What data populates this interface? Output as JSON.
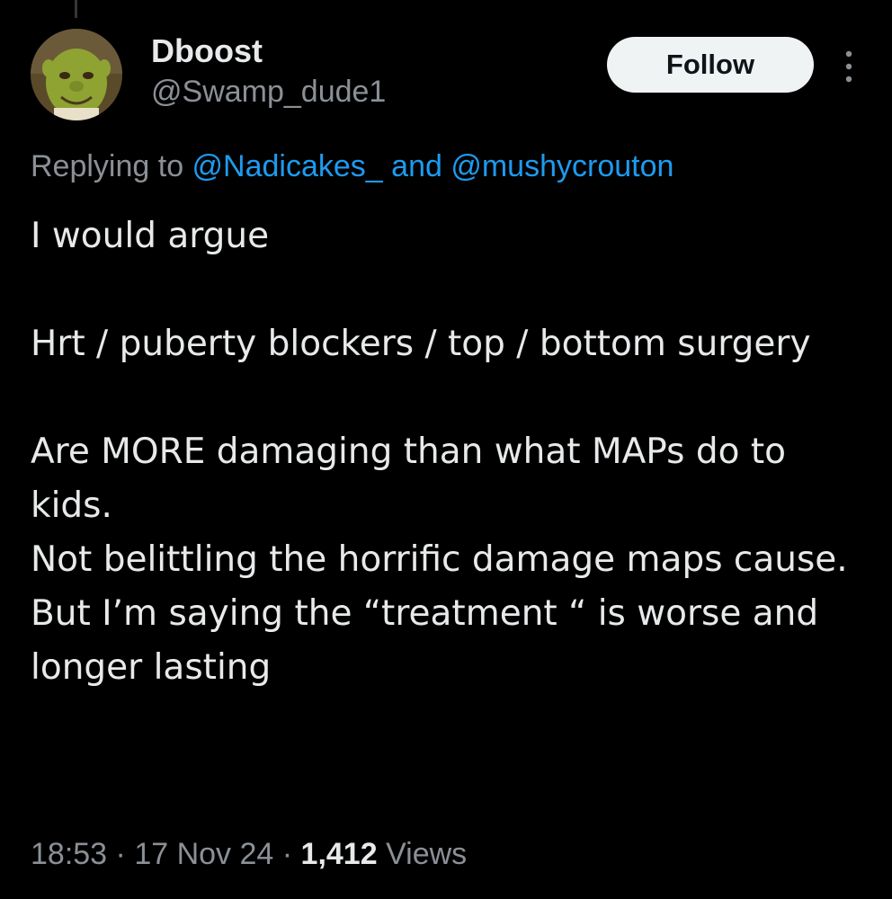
{
  "author": {
    "display_name": "Dboost",
    "handle": "@Swamp_dude1",
    "avatar_icon": "ogre-avatar"
  },
  "header": {
    "follow_label": "Follow",
    "more_icon": "more-vertical-icon"
  },
  "reply_context": {
    "prefix": "Replying to ",
    "mention_1": "@Nadicakes_",
    "conjunction": " and ",
    "mention_2": "@mushycrouton"
  },
  "tweet": {
    "lines": [
      "I would argue",
      "Hrt / puberty blockers / top / bottom surgery",
      "Are MORE damaging than what MAPs do to kids.",
      "Not belittling the horrific damage maps cause.",
      "But I’m saying the “treatment “ is worse and longer lasting"
    ]
  },
  "meta": {
    "time": "18:53",
    "separator": " · ",
    "date": "17 Nov 24",
    "views_count": "1,412",
    "views_label": " Views"
  },
  "colors": {
    "background": "#000000",
    "text_primary": "#e7e9ea",
    "text_secondary": "#8b9096",
    "link": "#1d9bf0",
    "button_bg": "#eff3f4"
  }
}
